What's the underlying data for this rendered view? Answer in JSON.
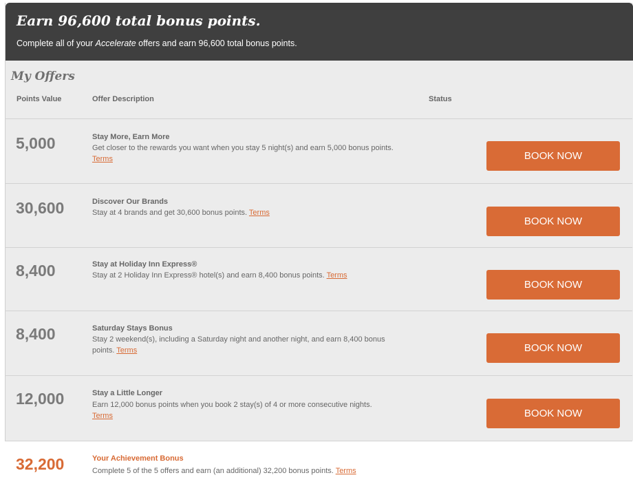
{
  "banner": {
    "title": "Earn 96,600 total bonus points.",
    "subtitle_pre": "Complete all of your ",
    "subtitle_em": "Accelerate",
    "subtitle_post": " offers and earn 96,600 total bonus points."
  },
  "section_title": "My Offers",
  "columns": {
    "points": "Points Value",
    "description": "Offer Description",
    "status": "Status"
  },
  "offers": [
    {
      "points": "5,000",
      "title": "Stay More, Earn More",
      "desc": "Get closer to the rewards you want when you stay 5 night(s) and earn 5,000 bonus points.",
      "terms": "Terms",
      "button": "BOOK NOW"
    },
    {
      "points": "30,600",
      "title": "Discover Our Brands",
      "desc": "Stay at 4 brands and get 30,600 bonus points.",
      "terms": "Terms",
      "button": "BOOK NOW"
    },
    {
      "points": "8,400",
      "title": "Stay at Holiday Inn Express®",
      "desc": "Stay at 2 Holiday Inn Express® hotel(s) and earn 8,400 bonus points.",
      "terms": "Terms",
      "button": "BOOK NOW"
    },
    {
      "points": "8,400",
      "title": "Saturday Stays Bonus",
      "desc": "Stay 2 weekend(s), including a Saturday night and another night, and earn 8,400 bonus points.",
      "terms": "Terms",
      "button": "BOOK NOW"
    },
    {
      "points": "12,000",
      "title": "Stay a Little Longer",
      "desc": "Earn 12,000 bonus points when you book 2 stay(s) of 4 or more consecutive nights.",
      "terms": "Terms",
      "button": "BOOK NOW"
    }
  ],
  "achievement": {
    "points": "32,200",
    "title": "Your Achievement Bonus",
    "desc": "Complete 5 of the 5 offers and earn (an additional) 32,200 bonus points.",
    "terms": "Terms"
  },
  "colors": {
    "banner_bg": "#3f3f3f",
    "panel_bg": "#ececec",
    "accent": "#d96b36"
  }
}
